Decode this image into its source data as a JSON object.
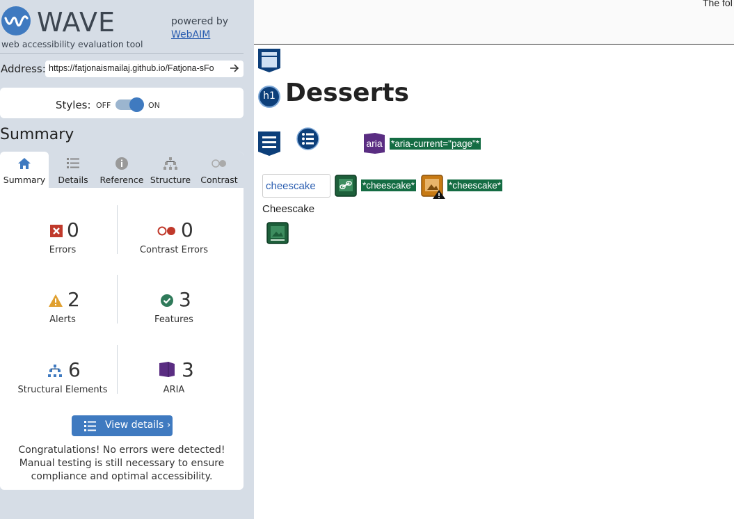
{
  "sidebar": {
    "logo": "WAVE",
    "subtitle": "web accessibility evaluation tool",
    "powered_by": "powered by",
    "webaim_link": "WebAIM",
    "address_label": "Address:",
    "address_value": "https://fatjonaismailaj.github.io/Fatjona-sFo",
    "styles_label": "Styles:",
    "styles_off": "OFF",
    "styles_on": "ON",
    "summary_title": "Summary",
    "tabs": [
      {
        "label": "Summary",
        "icon": "home-icon"
      },
      {
        "label": "Details",
        "icon": "list-icon"
      },
      {
        "label": "Reference",
        "icon": "info-icon"
      },
      {
        "label": "Structure",
        "icon": "structure-icon"
      },
      {
        "label": "Contrast",
        "icon": "contrast-icon"
      }
    ],
    "stats": {
      "errors": {
        "value": "0",
        "label": "Errors"
      },
      "contrast_errors": {
        "value": "0",
        "label": "Contrast Errors"
      },
      "alerts": {
        "value": "2",
        "label": "Alerts"
      },
      "features": {
        "value": "3",
        "label": "Features"
      },
      "structural": {
        "value": "6",
        "label": "Structural Elements"
      },
      "aria": {
        "value": "3",
        "label": "ARIA"
      }
    },
    "view_details": "View details ›",
    "congrats": "Congratulations! No errors were detected! Manual testing is still necessary to ensure compliance and optimal accessibility."
  },
  "page": {
    "top_clip": "The fol",
    "h1_badge": "h1",
    "heading": "Desserts",
    "aria_badge": "aria",
    "aria_current": "*aria-current=\"page\"*",
    "img_alt": "cheescake",
    "alt_chip_1": "*cheescake*",
    "alt_chip_2": "*cheescake*",
    "caption": "Cheescake"
  },
  "colors": {
    "accent": "#3f7ac0",
    "sidebar_bg": "#d6dde6",
    "feature_green": "#146c43",
    "aria_purple": "#5a2d82",
    "alert_orange": "#e0a030",
    "error_red": "#c0392b"
  }
}
